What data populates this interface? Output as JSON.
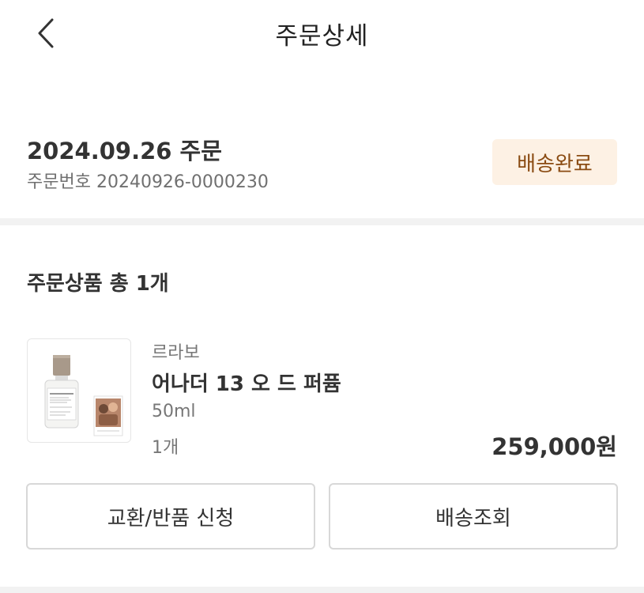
{
  "header": {
    "title": "주문상세",
    "back_icon": "chevron-left-icon"
  },
  "order": {
    "date_label": "2024.09.26 주문",
    "number_label": "주문번호 20240926-0000230",
    "status": "배송완료",
    "status_colors": {
      "bg": "#fdf1e4",
      "text": "#8a4b12"
    }
  },
  "products_section": {
    "title": "주문상품 총 1개"
  },
  "product": {
    "brand": "르라보",
    "name": "어나더 13 오 드 퍼퓸",
    "option": "50ml",
    "quantity": "1개",
    "price": "259,000원",
    "image_icon": "perfume-bottle-icon"
  },
  "actions": {
    "exchange_return": "교환/반품 신청",
    "tracking": "배송조회"
  }
}
